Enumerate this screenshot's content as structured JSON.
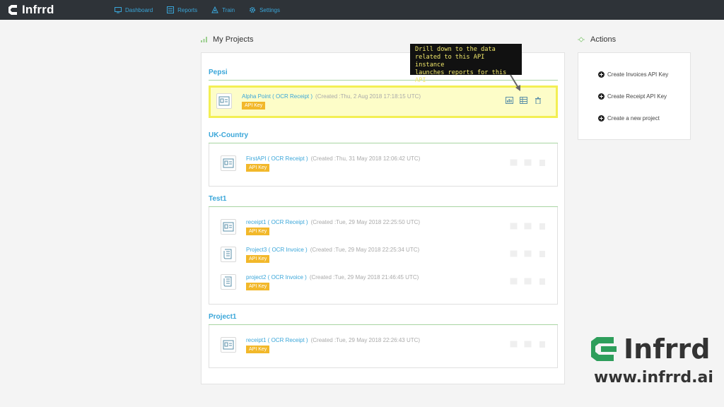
{
  "app": {
    "name": "Infrrd"
  },
  "nav": [
    {
      "label": "Dashboard",
      "icon": "monitor-icon"
    },
    {
      "label": "Reports",
      "icon": "reports-icon"
    },
    {
      "label": "Train",
      "icon": "train-icon"
    },
    {
      "label": "Settings",
      "icon": "gear-icon"
    }
  ],
  "projects_section": {
    "title": "My Projects"
  },
  "actions_section": {
    "title": "Actions",
    "items": [
      "Create Invoices API Key",
      "Create Receipt API Key",
      "Create a new project"
    ]
  },
  "groups": [
    {
      "name": "Pepsi",
      "projects": [
        {
          "name": "Alpha Point ( OCR Receipt )",
          "created": "(Created :Thu, 2 Aug 2018 17:18:15 UTC)",
          "badge": "API Key",
          "type": "receipt"
        }
      ]
    },
    {
      "name": "UK-Country",
      "projects": [
        {
          "name": "FirstAPI ( OCR Receipt )",
          "created": "(Created :Thu, 31 May 2018 12:06:42 UTC)",
          "badge": "API Key",
          "type": "receipt"
        }
      ]
    },
    {
      "name": "Test1",
      "projects": [
        {
          "name": "receipt1 ( OCR Receipt )",
          "created": "(Created :Tue, 29 May 2018 22:25:50 UTC)",
          "badge": "API Key",
          "type": "receipt"
        },
        {
          "name": "Project3 ( OCR Invoice )",
          "created": "(Created :Tue, 29 May 2018 22:25:34 UTC)",
          "badge": "API Key",
          "type": "invoice"
        },
        {
          "name": "project2 ( OCR Invoice )",
          "created": "(Created :Tue, 29 May 2018 21:46:45 UTC)",
          "badge": "API Key",
          "type": "invoice"
        }
      ]
    },
    {
      "name": "Project1",
      "projects": [
        {
          "name": "receipt1 ( OCR Receipt )",
          "created": "(Created :Tue, 29 May 2018 22:26:43 UTC)",
          "badge": "API Key",
          "type": "receipt"
        }
      ]
    }
  ],
  "tooltip": {
    "lines": [
      "Drill down to the data",
      "related to this API instance",
      "launches reports for this API"
    ]
  },
  "brand": {
    "name": "Infrrd",
    "url": "www.infrrd.ai"
  },
  "colors": {
    "topbar": "#2e3338",
    "accent": "#3aa6d9",
    "badge": "#f2b82a",
    "highlight": "#fdfdc8",
    "logo_green": "#2e9e5b"
  }
}
